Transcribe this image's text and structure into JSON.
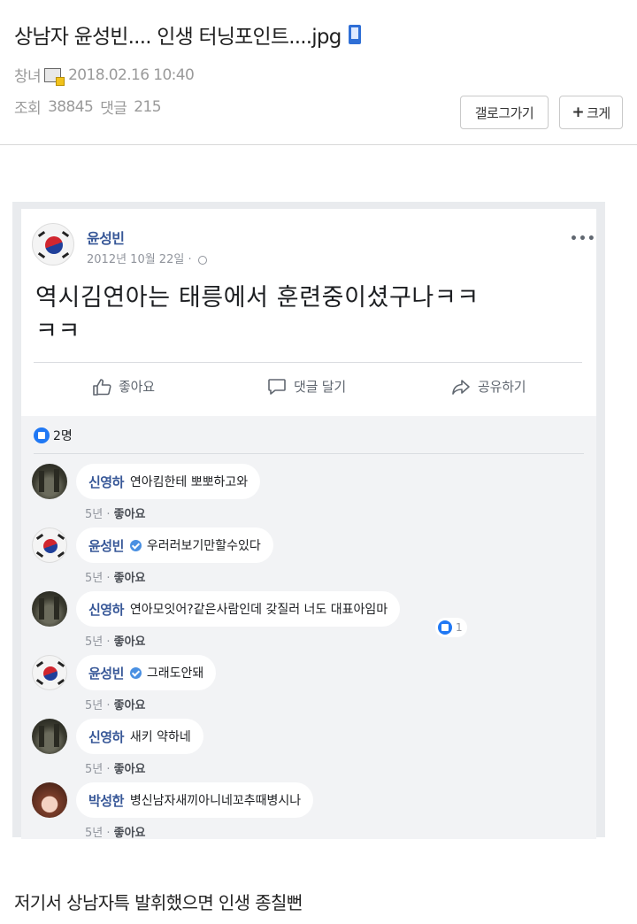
{
  "post": {
    "title": "상남자 윤성빈.... 인생 터닝포인트....jpg",
    "author": "창녀",
    "datetime": "2018.02.16 10:40",
    "views_label": "조회",
    "views": "38845",
    "comments_label": "댓글",
    "comments": "215",
    "caption": "저기서 상남자특 발휘했으면 인생 종칠뻔"
  },
  "buttons": {
    "gallery": "갤로그가기",
    "enlarge": "크게"
  },
  "icons": {
    "phone": "mobile-phone-icon",
    "level": "user-level-icon",
    "plus": "plus-icon"
  },
  "fb_post": {
    "author": "윤성빈",
    "date": "2012년 10월 22일 ·",
    "text_line1": "역시김연아는 태릉에서 훈련중이셨구나ㅋㅋ",
    "text_line2": "ㅋㅋ",
    "more": "•••",
    "actions": {
      "like": "좋아요",
      "comment": "댓글 달기",
      "share": "공유하기"
    },
    "reaction_count": "2명",
    "comment_meta_time": "5년 ·",
    "comment_meta_like": "좋아요"
  },
  "comments": [
    {
      "name": "신영하",
      "text": "연아킴한테 뽀뽀하고와",
      "verified": false,
      "avatar": "forest"
    },
    {
      "name": "윤성빈",
      "text": "우러러보기만할수있다",
      "verified": true,
      "avatar": "flag"
    },
    {
      "name": "신영하",
      "text": "연아모잇어?같은사람인데 갖질러 너도 대표아임마",
      "verified": false,
      "avatar": "forest",
      "likes": "1"
    },
    {
      "name": "윤성빈",
      "text": "그래도안돼",
      "verified": true,
      "avatar": "flag"
    },
    {
      "name": "신영하",
      "text": "새키 약하네",
      "verified": false,
      "avatar": "forest"
    },
    {
      "name": "박성한",
      "text": "병신남자새끼아니네꼬추때병시나",
      "verified": false,
      "avatar": "person"
    }
  ],
  "colors": {
    "fb_blue": "#385898",
    "like_blue": "#2078f4",
    "meta_gray": "#90949c"
  }
}
